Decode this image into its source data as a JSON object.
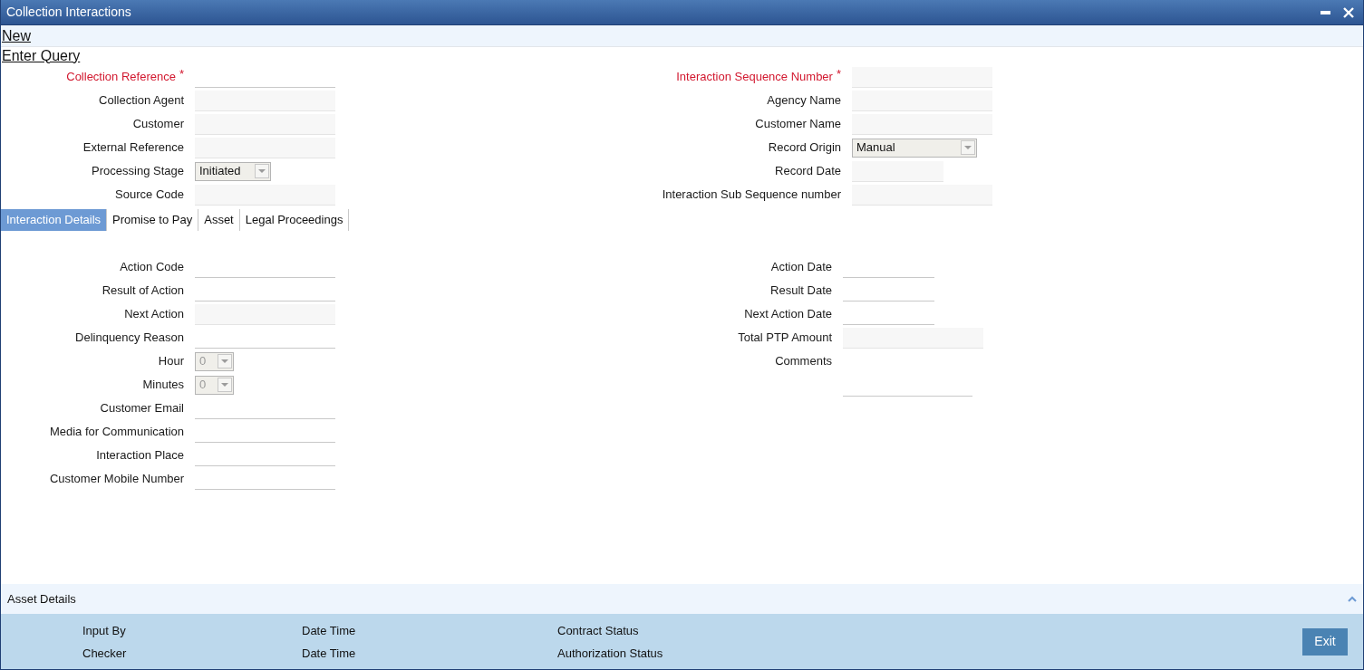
{
  "window": {
    "title": "Collection Interactions"
  },
  "menu": [
    {
      "label": "New",
      "highlighted": true
    },
    {
      "label": "Enter Query",
      "highlighted": false
    }
  ],
  "header": {
    "left": [
      {
        "label": "Collection Reference",
        "required": true,
        "marker": "*",
        "kind": "entry"
      },
      {
        "label": "Collection Agent",
        "required": false,
        "kind": "input"
      },
      {
        "label": "Customer",
        "required": false,
        "kind": "input"
      },
      {
        "label": "External Reference",
        "required": false,
        "kind": "input"
      },
      {
        "label": "Processing Stage",
        "required": false,
        "kind": "select",
        "value": "Initiated",
        "disabled": false
      },
      {
        "label": "Source Code",
        "required": false,
        "kind": "input"
      }
    ],
    "right": [
      {
        "label": "Interaction Sequence Number",
        "required": true,
        "marker": "*",
        "kind": "input"
      },
      {
        "label": "Agency Name",
        "required": false,
        "kind": "input"
      },
      {
        "label": "Customer Name",
        "required": false,
        "kind": "input"
      },
      {
        "label": "Record Origin",
        "required": false,
        "kind": "select",
        "value": "Manual",
        "disabled": false
      },
      {
        "label": "Record Date",
        "required": false,
        "kind": "date"
      },
      {
        "label": "Interaction Sub Sequence number",
        "required": false,
        "kind": "input"
      }
    ]
  },
  "tabs": [
    {
      "label": "Interaction Details",
      "selected": true
    },
    {
      "label": "Promise to Pay",
      "selected": false
    },
    {
      "label": "Asset",
      "selected": false
    },
    {
      "label": "Legal Proceedings",
      "selected": false
    }
  ],
  "details": {
    "left": [
      {
        "label": "Action Code",
        "kind": "entry"
      },
      {
        "label": "Result of Action",
        "kind": "entry"
      },
      {
        "label": "Next Action",
        "kind": "input"
      },
      {
        "label": "Delinquency Reason",
        "kind": "entry"
      },
      {
        "label": "Hour",
        "kind": "select",
        "value": "0",
        "disabled": true
      },
      {
        "label": "Minutes",
        "kind": "select",
        "value": "0",
        "disabled": true
      },
      {
        "label": "Customer Email",
        "kind": "entry"
      },
      {
        "label": "Media for Communication",
        "kind": "entry"
      },
      {
        "label": "Interaction Place",
        "kind": "entry"
      },
      {
        "label": "Customer Mobile Number",
        "kind": "entry"
      }
    ],
    "right": [
      {
        "label": "Action Date",
        "kind": "dateentry"
      },
      {
        "label": "Result Date",
        "kind": "dateentry"
      },
      {
        "label": "Next Action Date",
        "kind": "dateentry"
      },
      {
        "label": "Total PTP Amount",
        "kind": "input"
      },
      {
        "label": "Comments",
        "kind": "textarea"
      }
    ]
  },
  "asset_details": {
    "label": "Asset Details"
  },
  "audit": [
    [
      "Input By",
      "Date Time",
      "Contract Status"
    ],
    [
      "Checker",
      "Date Time",
      "Authorization Status"
    ]
  ],
  "buttons": [
    {
      "label": "Exit"
    }
  ]
}
